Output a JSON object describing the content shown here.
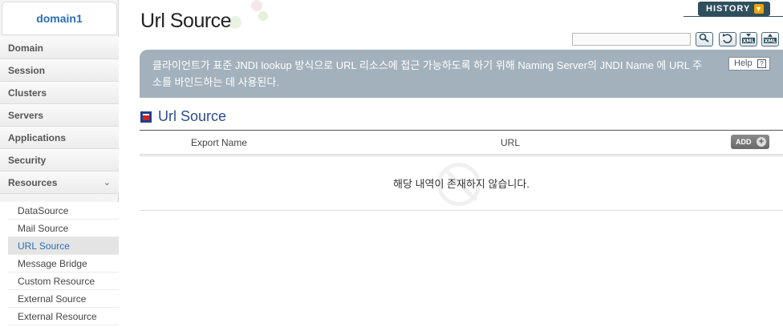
{
  "sidebar": {
    "domain": "domain1",
    "menu": [
      "Domain",
      "Session",
      "Clusters",
      "Servers",
      "Applications",
      "Security",
      "Resources"
    ],
    "submenu": [
      "DataSource",
      "Mail Source",
      "URL Source",
      "Message Bridge",
      "Custom Resource",
      "External Source",
      "External Resource"
    ],
    "active_sub": "URL Source"
  },
  "header": {
    "title": "Url Source",
    "history_label": "HISTORY"
  },
  "toolbar": {
    "search_value": "",
    "icons": [
      "search-icon",
      "refresh-icon",
      "xml-export-icon",
      "xml-import-icon"
    ]
  },
  "info": {
    "text": "클라이언트가 표준 JNDI lookup 방식으로 URL 리소스에 접근 가능하도록 하기 위해 Naming Server의 JNDI Name 에 URL 주소를 바인드하는 데 사용된다.",
    "help_label": "Help"
  },
  "section": {
    "title": "Url Source"
  },
  "table": {
    "columns": [
      "Export Name",
      "URL"
    ],
    "add_label": "ADD",
    "empty_message": "해당 내역이 존재하지 않습니다."
  },
  "colors": {
    "accent": "#2a6fb5",
    "info_bg": "#a3b1bc",
    "history_bg": "#2f4f5d"
  }
}
